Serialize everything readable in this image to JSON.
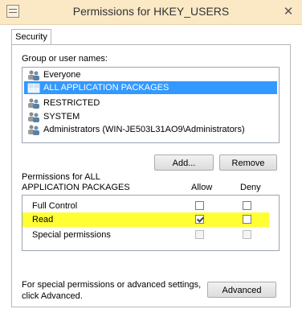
{
  "window": {
    "title": "Permissions for HKEY_USERS",
    "close_glyph": "✕"
  },
  "tabs": [
    {
      "label": "Security"
    }
  ],
  "groups": {
    "label": "Group or user names:",
    "items": [
      {
        "name": "Everyone",
        "icon": "users-icon",
        "selected": false
      },
      {
        "name": "ALL APPLICATION PACKAGES",
        "icon": "package-group-icon",
        "selected": true
      },
      {
        "name": "RESTRICTED",
        "icon": "users-icon",
        "selected": false
      },
      {
        "name": "SYSTEM",
        "icon": "users-icon",
        "selected": false
      },
      {
        "name": "Administrators (WIN-JE503L31AO9\\Administrators)",
        "icon": "users-icon",
        "selected": false
      }
    ]
  },
  "buttons": {
    "add": "Add...",
    "remove": "Remove",
    "advanced": "Advanced"
  },
  "permissions": {
    "label_line1": "Permissions for ALL",
    "label_line2": "APPLICATION PACKAGES",
    "allow_header": "Allow",
    "deny_header": "Deny",
    "rows": [
      {
        "name": "Full Control",
        "allow": false,
        "deny": false,
        "disabled": false,
        "highlight": false
      },
      {
        "name": "Read",
        "allow": true,
        "deny": false,
        "disabled": false,
        "highlight": true
      },
      {
        "name": "Special permissions",
        "allow": false,
        "deny": false,
        "disabled": true,
        "highlight": false
      }
    ]
  },
  "footer": {
    "line1": "For special permissions or advanced settings,",
    "line2": "click Advanced."
  },
  "colors": {
    "selection": "#3399ff",
    "highlight": "#ffff33",
    "titlebar": "#fbe9c6"
  }
}
